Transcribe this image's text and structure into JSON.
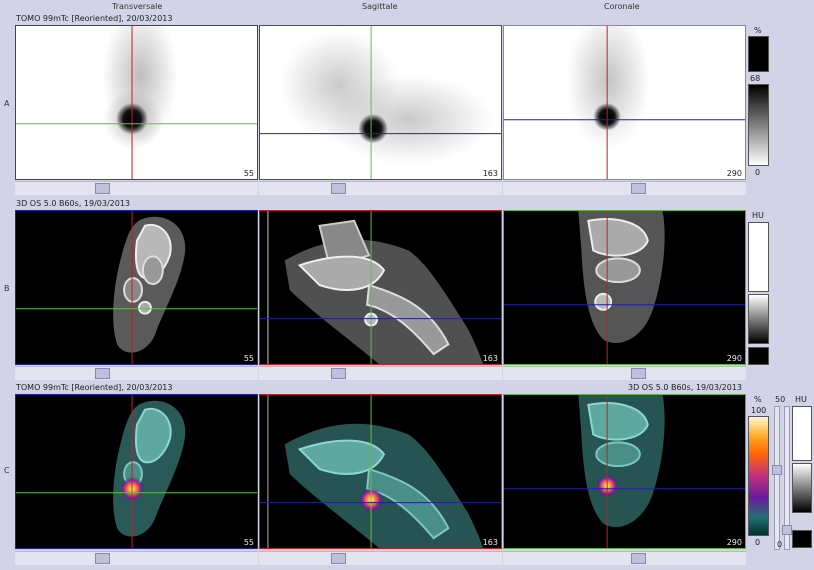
{
  "columns": {
    "transversal": "Transversale",
    "sagittal": "Sagittale",
    "coronal": "Coronale"
  },
  "rows": {
    "a": {
      "label": "A",
      "title": "TOMO 99mTc [Reoriented], 20/03/2013"
    },
    "b": {
      "label": "B",
      "title": "3D  OS  5.0  B60s, 19/03/2013"
    },
    "c": {
      "label": "C",
      "title": "TOMO 99mTc [Reoriented], 20/03/2013",
      "title_right": "3D  OS  5.0  B60s, 19/03/2013"
    }
  },
  "slices": {
    "transversal": "55",
    "sagittal": "163",
    "coronal": "290"
  },
  "scales": {
    "a": {
      "unit": "%",
      "max": "68",
      "min": "0"
    },
    "b": {
      "unit": "HU"
    },
    "c": {
      "unit_left": "%",
      "max_left": "100",
      "min_left": "0",
      "value_mid": "50",
      "unit_right": "HU",
      "min_right": "0"
    }
  },
  "colors": {
    "background": "#d3d3e8",
    "crosshair_red": "#c02020",
    "crosshair_green": "#60c040",
    "crosshair_blue": "#2020a0"
  }
}
